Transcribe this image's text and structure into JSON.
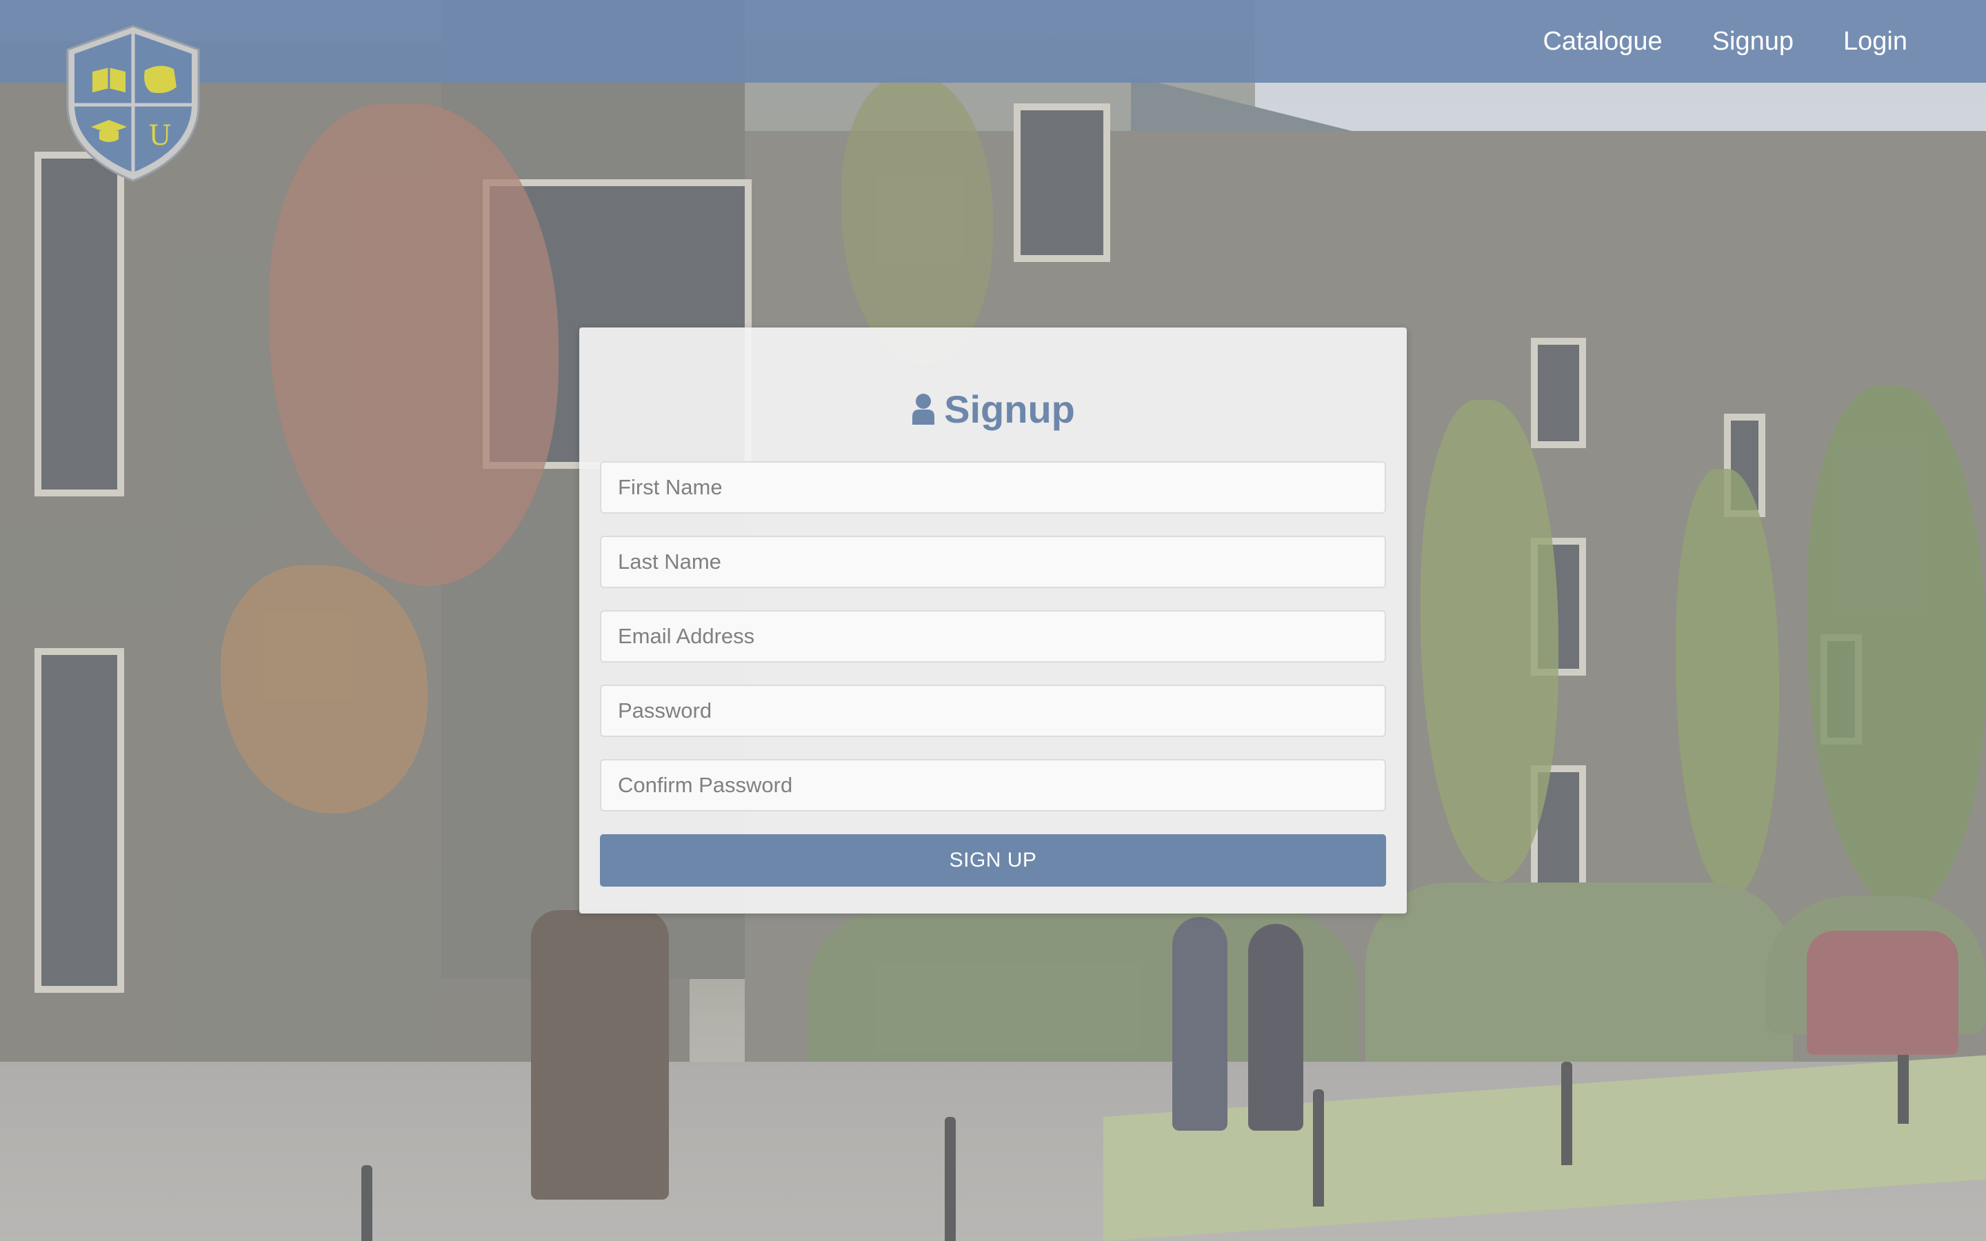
{
  "nav": {
    "catalogue": "Catalogue",
    "signup": "Signup",
    "login": "Login"
  },
  "logo": {
    "letter": "U",
    "icon": "university-crest-icon"
  },
  "signup": {
    "title": "Signup",
    "title_icon": "user-icon",
    "first_name_placeholder": "First Name",
    "last_name_placeholder": "Last Name",
    "email_placeholder": "Email Address",
    "password_placeholder": "Password",
    "confirm_password_placeholder": "Confirm Password",
    "submit_label": "SIGN UP"
  },
  "colors": {
    "accent": "#6d87ab",
    "navbar": "#6e89ae",
    "crest_gold": "#d8d24a"
  }
}
